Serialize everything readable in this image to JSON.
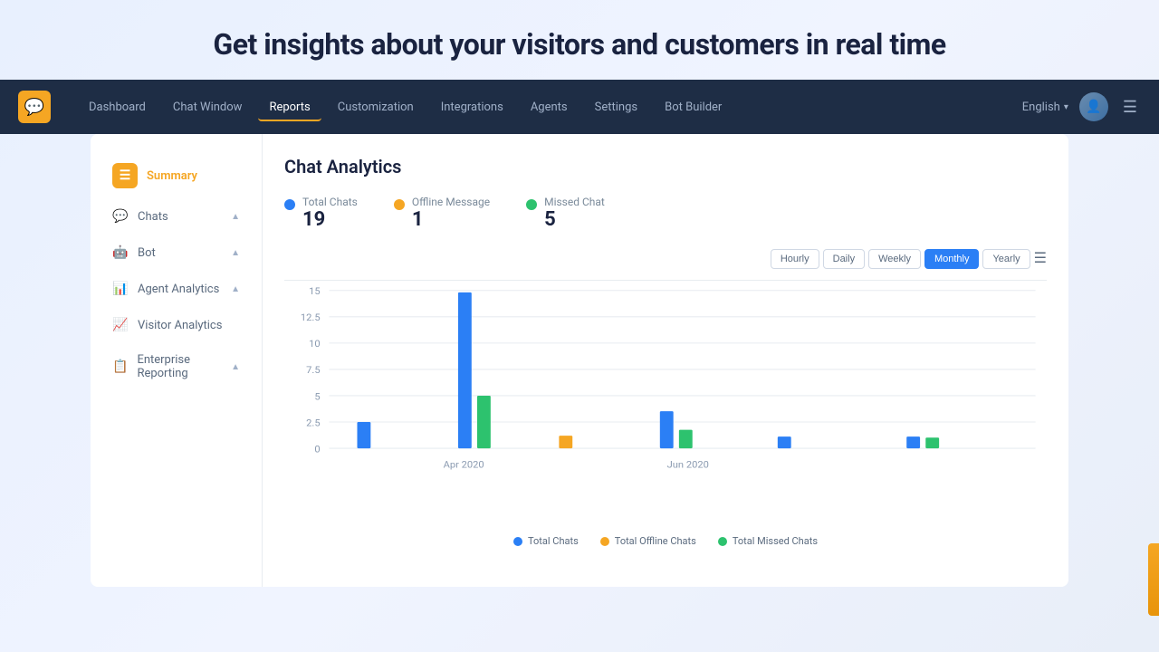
{
  "hero": {
    "title": "Get insights about your visitors and customers in real time"
  },
  "navbar": {
    "logo_icon": "💬",
    "links": [
      {
        "label": "Dashboard",
        "active": false
      },
      {
        "label": "Chat Window",
        "active": false
      },
      {
        "label": "Reports",
        "active": true
      },
      {
        "label": "Customization",
        "active": false
      },
      {
        "label": "Integrations",
        "active": false
      },
      {
        "label": "Agents",
        "active": false
      },
      {
        "label": "Settings",
        "active": false
      },
      {
        "label": "Bot Builder",
        "active": false
      }
    ],
    "language": "English",
    "language_dropdown_arrow": "▾"
  },
  "sidebar": {
    "items": [
      {
        "label": "Summary",
        "active": true,
        "has_chevron": false
      },
      {
        "label": "Chats",
        "active": false,
        "has_chevron": true
      },
      {
        "label": "Bot",
        "active": false,
        "has_chevron": true
      },
      {
        "label": "Agent Analytics",
        "active": false,
        "has_chevron": true
      },
      {
        "label": "Visitor Analytics",
        "active": false,
        "has_chevron": false
      },
      {
        "label": "Enterprise Reporting",
        "active": false,
        "has_chevron": true
      }
    ]
  },
  "content": {
    "title": "Chat Analytics",
    "stats": [
      {
        "label": "Total Chats",
        "value": "19",
        "color_class": "blue"
      },
      {
        "label": "Offline Message",
        "value": "1",
        "color_class": "orange"
      },
      {
        "label": "Missed Chat",
        "value": "5",
        "color_class": "green"
      }
    ],
    "chart_buttons": [
      {
        "label": "Hourly",
        "active": false
      },
      {
        "label": "Daily",
        "active": false
      },
      {
        "label": "Weekly",
        "active": false
      },
      {
        "label": "Monthly",
        "active": true
      },
      {
        "label": "Yearly",
        "active": false
      }
    ],
    "y_axis": [
      "15",
      "12.5",
      "10",
      "7.5",
      "5",
      "2.5",
      "0"
    ],
    "x_labels": [
      "Apr 2020",
      "Jun 2020"
    ],
    "legend": [
      {
        "label": "Total Chats",
        "color": "#2b7ff5"
      },
      {
        "label": "Total Offline Chats",
        "color": "#f5a623"
      },
      {
        "label": "Total Missed Chats",
        "color": "#2dc26e"
      }
    ]
  }
}
